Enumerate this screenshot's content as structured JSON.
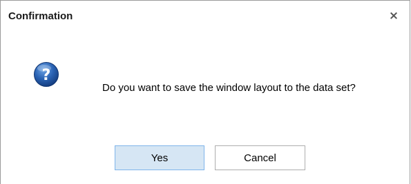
{
  "dialog": {
    "title": "Confirmation",
    "close_glyph": "×",
    "icon": "question-icon",
    "message": "Do you want to save the window layout to the data set?",
    "buttons": {
      "yes_label": "Yes",
      "cancel_label": "Cancel"
    },
    "colors": {
      "icon_blue": "#1e5aa8",
      "primary_button_bg": "#d6e6f4",
      "primary_button_border": "#7eb4ea"
    }
  }
}
